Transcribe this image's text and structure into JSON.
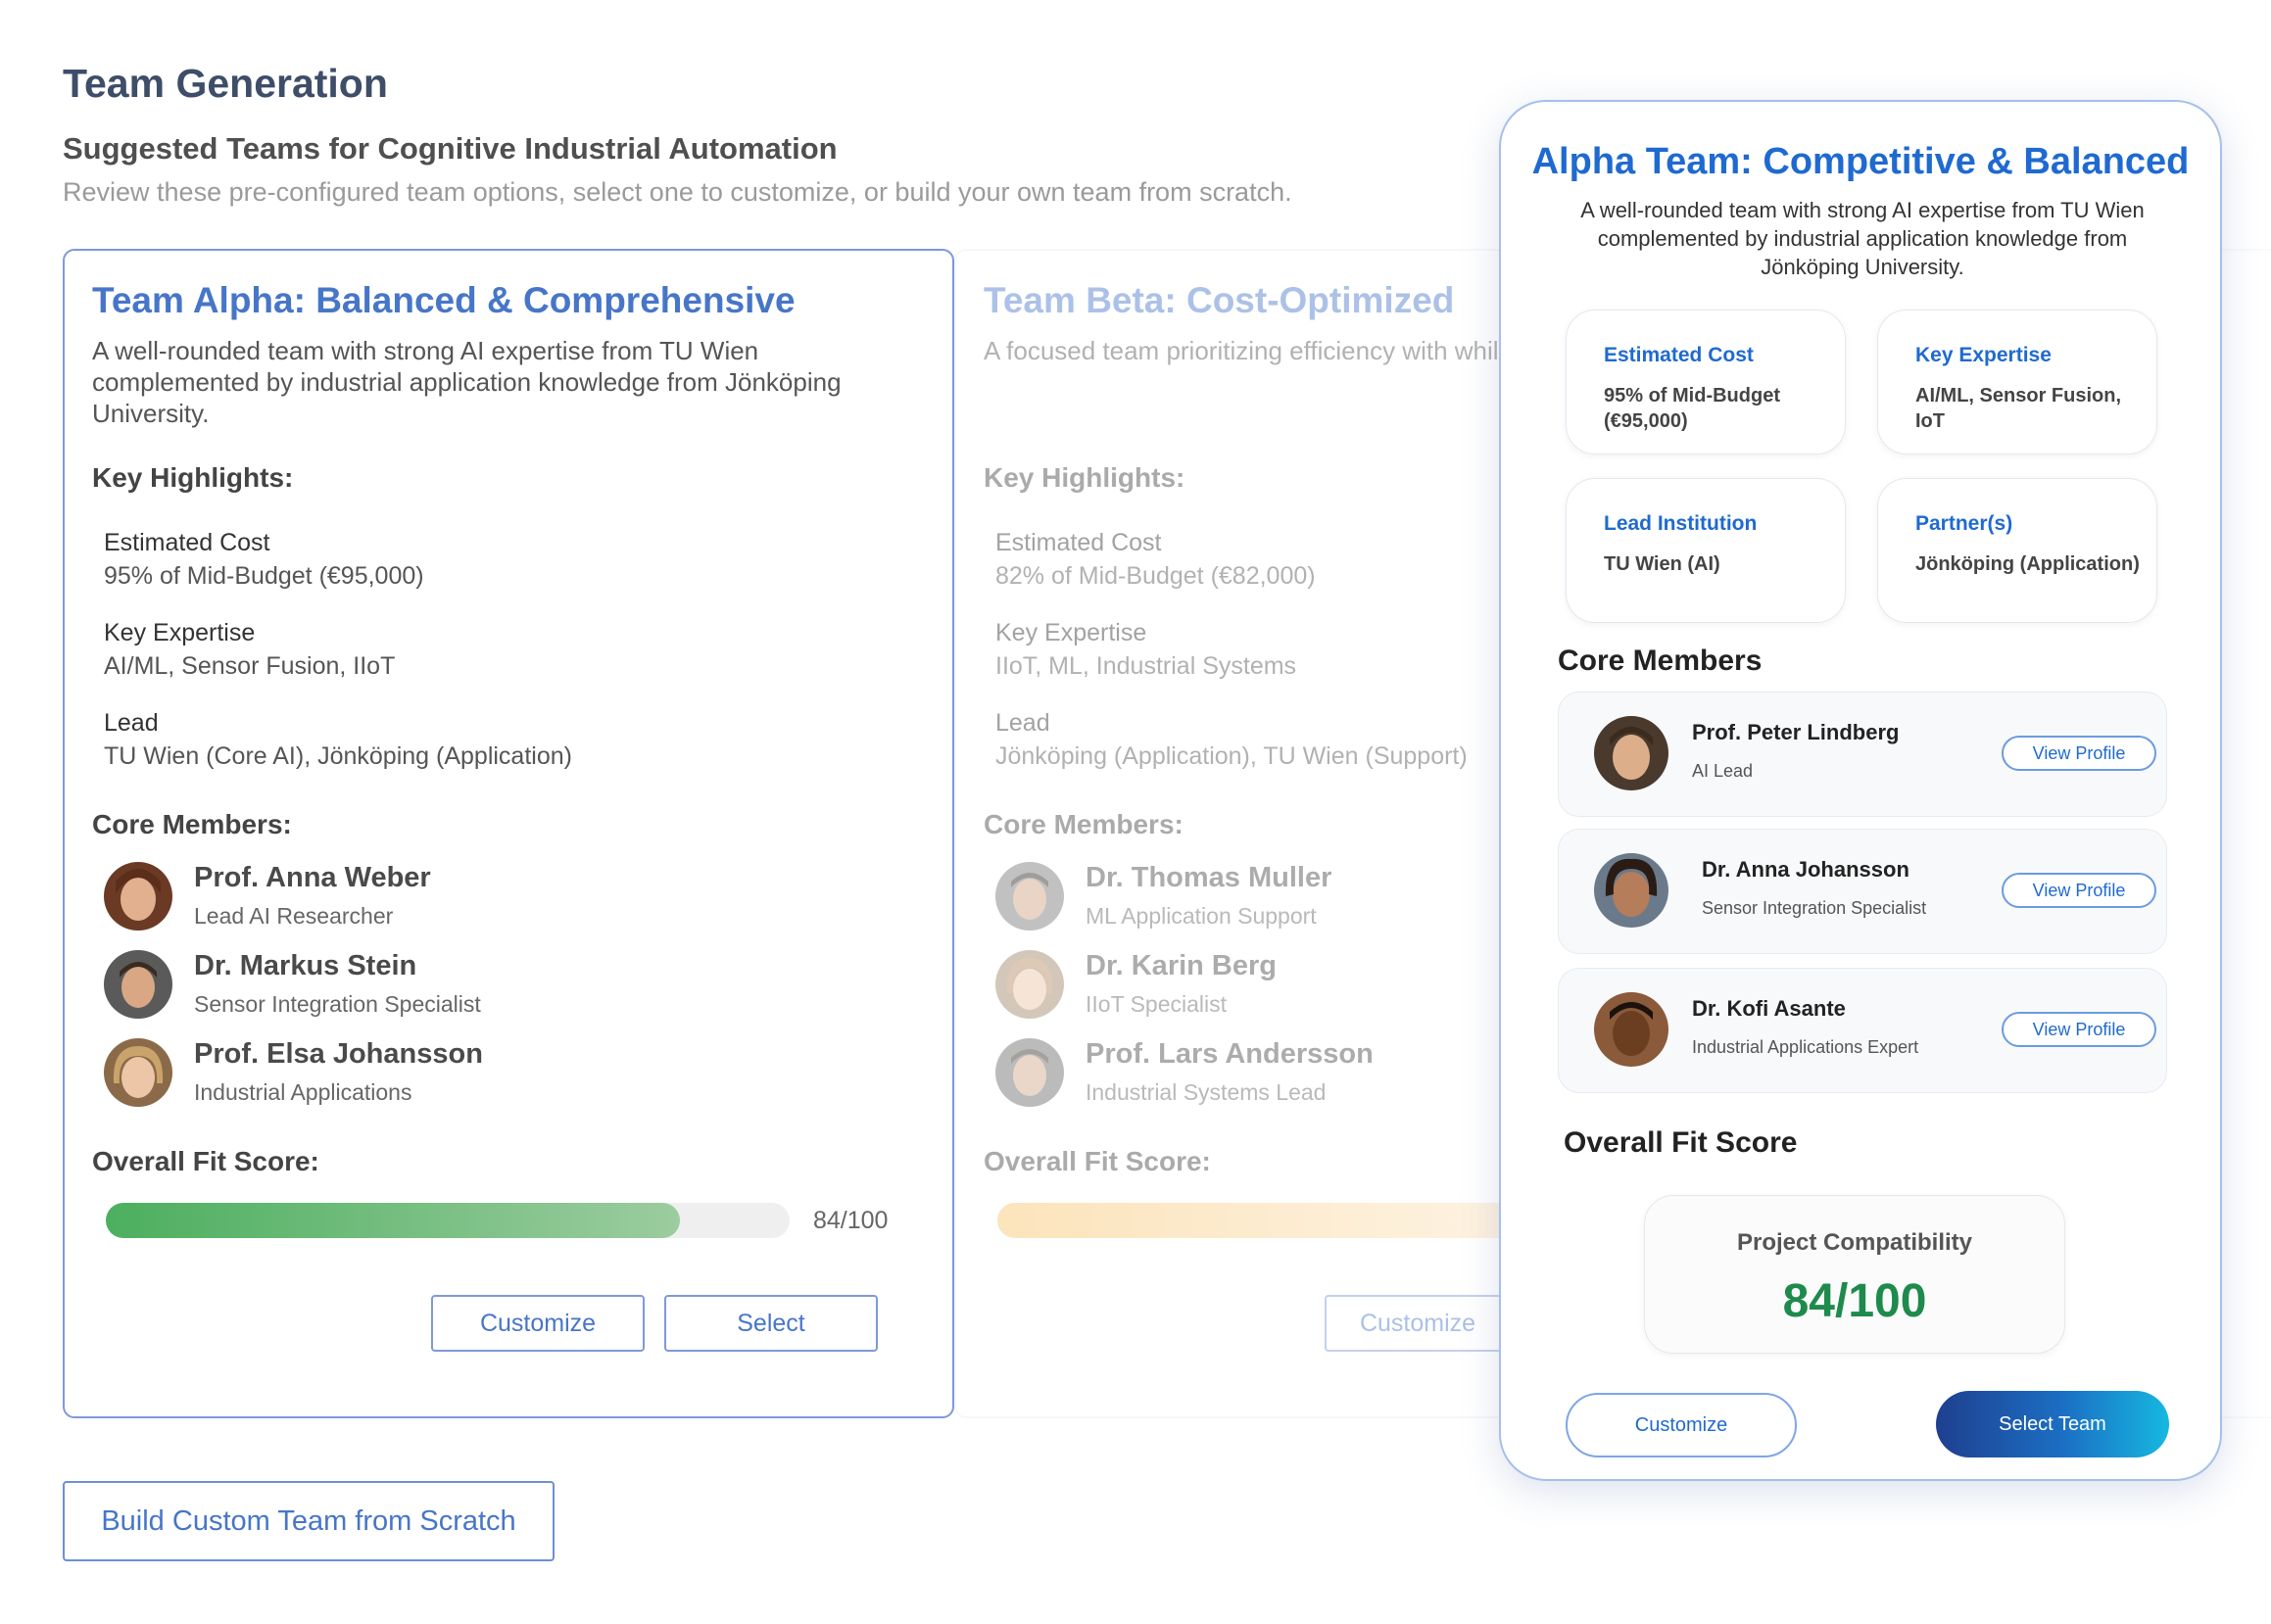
{
  "header": {
    "title": "Team Generation",
    "subtitle": "Suggested Teams for Cognitive Industrial Automation",
    "description": "Review these pre-configured team options, select one to customize, or build your own team from scratch."
  },
  "cards": [
    {
      "title": "Team Alpha: Balanced & Comprehensive",
      "description": "A well-rounded team with strong AI expertise from TU Wien complemented by industrial application knowledge from Jönköping University.",
      "highlights_heading": "Key Highlights:",
      "highlights": [
        {
          "label": "Estimated Cost",
          "value": "95% of Mid-Budget (€95,000)"
        },
        {
          "label": "Key Expertise",
          "value": "AI/ML, Sensor Fusion, IIoT"
        },
        {
          "label": "Lead",
          "value": "TU Wien (Core AI), Jönköping (Application)"
        }
      ],
      "members_heading": "Core Members:",
      "members": [
        {
          "name": "Prof. Anna Weber",
          "role": "Lead AI Researcher"
        },
        {
          "name": "Dr. Markus Stein",
          "role": "Sensor Integration Specialist"
        },
        {
          "name": "Prof. Elsa Johansson",
          "role": "Industrial Applications"
        }
      ],
      "fit_heading": "Overall Fit Score:",
      "fit_score": 84,
      "fit_label": "84/100",
      "customize_label": "Customize",
      "select_label": "Select"
    },
    {
      "title": "Team Beta: Cost-Optimized",
      "description": "A focused team prioritizing efficiency with while maintaining essential coverage of all",
      "highlights_heading": "Key Highlights:",
      "highlights": [
        {
          "label": "Estimated Cost",
          "value": "82% of Mid-Budget (€82,000)"
        },
        {
          "label": "Key Expertise",
          "value": "IIoT, ML, Industrial Systems"
        },
        {
          "label": "Lead",
          "value": "Jönköping (Application), TU Wien (Support)"
        }
      ],
      "members_heading": "Core Members:",
      "members": [
        {
          "name": "Dr. Thomas Muller",
          "role": "ML Application Support"
        },
        {
          "name": "Dr. Karin Berg",
          "role": "IIoT Specialist"
        },
        {
          "name": "Prof. Lars Andersson",
          "role": "Industrial Systems Lead"
        }
      ],
      "fit_heading": "Overall Fit Score:",
      "customize_label": "Customize"
    }
  ],
  "build_custom_label": "Build Custom Team from Scratch",
  "panel": {
    "title": "Alpha Team: Competitive & Balanced",
    "description": "A well-rounded team with strong AI expertise from TU Wien complemented by industrial application knowledge from Jönköping University.",
    "boxes": [
      {
        "label": "Estimated Cost",
        "value": "95% of Mid-Budget (€95,000)"
      },
      {
        "label": "Key Expertise",
        "value": "AI/ML, Sensor Fusion, IoT"
      },
      {
        "label": "Lead Institution",
        "value": "TU Wien (AI)"
      },
      {
        "label": "Partner(s)",
        "value": "Jönköping  (Application)"
      }
    ],
    "members_heading": "Core Members",
    "members": [
      {
        "name": "Prof. Peter Lindberg",
        "role": "AI Lead",
        "action": "View Profile"
      },
      {
        "name": "Dr. Anna Johansson",
        "role": "Sensor Integration Specialist",
        "action": "View Profile"
      },
      {
        "name": "Dr. Kofi Asante",
        "role": "Industrial Applications Expert",
        "action": "View Profile"
      }
    ],
    "fit_heading": "Overall Fit Score",
    "score_label": "Project Compatibility",
    "score_value": "84/100",
    "customize_label": "Customize",
    "select_label": "Select Team"
  },
  "colors": {
    "accent": "#4776c8",
    "panel_accent": "#1f6ad0",
    "alpha_bar_start": "#4caf5f",
    "alpha_bar_end": "#9ccc9f",
    "beta_bar_start": "#f9c46b",
    "beta_bar_end": "#fde7c4",
    "score_green": "#1e8a4c"
  }
}
